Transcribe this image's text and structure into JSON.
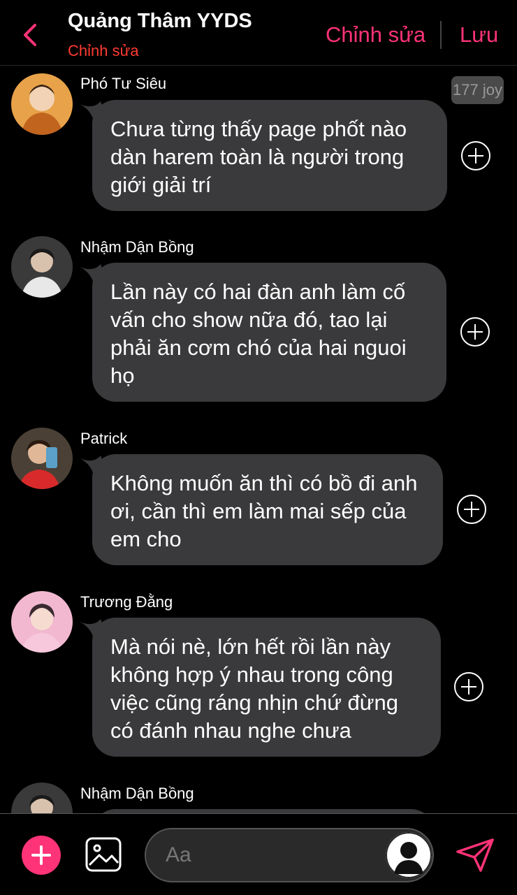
{
  "header": {
    "title": "Quảng Thâm YYDS",
    "subtitle": "Chỉnh sửa",
    "edit_label": "Chỉnh sửa",
    "save_label": "Lưu"
  },
  "messages": [
    {
      "sender": "Phó Tư Siêu",
      "text": "Chưa từng thấy page phốt nào dàn harem toàn là người trong giới giải trí",
      "badge": "177 joy"
    },
    {
      "sender": "Nhậm Dận Bồng",
      "text": "Lần này có hai đàn anh làm cố vấn cho show nữa đó, tao lại phải ăn cơm chó của hai nguoi họ"
    },
    {
      "sender": "Patrick",
      "text": "Không muốn ăn thì có bồ đi anh ơi, cần thì em làm mai sếp của em cho"
    },
    {
      "sender": "Trương Đằng",
      "text": "Mà nói nè, lớn hết rồi lần này không hợp ý nhau trong công việc cũng ráng nhịn chứ đừng có đánh nhau nghe chưa"
    },
    {
      "sender": "Nhậm Dận Bồng",
      "text": ""
    }
  ],
  "composer": {
    "placeholder": "Aa"
  },
  "colors": {
    "accent": "#ff3377",
    "subtitle": "#ff3b30",
    "bubble": "#3a3a3c"
  }
}
